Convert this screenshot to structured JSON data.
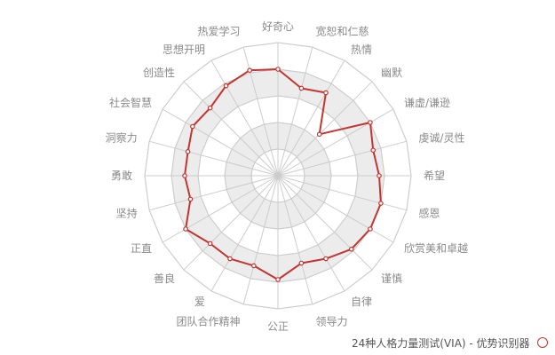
{
  "chart_data": {
    "type": "radar",
    "max": 5,
    "categories": [
      "好奇心",
      "宽恕和仁慈",
      "热情",
      "幽默",
      "谦虚/谦逊",
      "虔诚/灵性",
      "希望",
      "感恩",
      "欣赏美和卓越",
      "谨慎",
      "自律",
      "领导力",
      "公正",
      "团队合作精神",
      "爱",
      "善良",
      "正直",
      "坚持",
      "勇敢",
      "洞察力",
      "社会智慧",
      "创造性",
      "思想开明",
      "热爱学习"
    ],
    "series": [
      {
        "name": "24种人格力量测试(VIA) - 优势识别器",
        "color": "#c23531",
        "values": [
          4.0,
          3.4,
          3.6,
          2.2,
          4.0,
          3.7,
          3.8,
          4.0,
          4.0,
          3.9,
          3.6,
          3.4,
          3.9,
          3.5,
          3.6,
          3.6,
          4.0,
          3.4,
          3.5,
          3.5,
          3.7,
          3.6,
          3.9,
          4.1
        ]
      }
    ],
    "split_number": 5,
    "split_area_colors": [
      "#ffffff",
      "#ececec"
    ]
  },
  "legend": {
    "label": "24种人格力量测试(VIA) - 优势识别器"
  }
}
